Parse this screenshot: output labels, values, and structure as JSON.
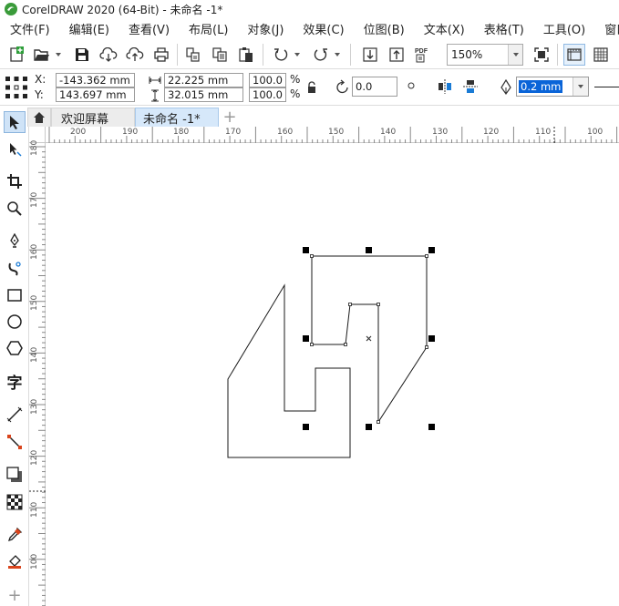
{
  "title": "CorelDRAW 2020 (64-Bit) - 未命名 -1*",
  "menu": [
    "文件(F)",
    "编辑(E)",
    "查看(V)",
    "布局(L)",
    "对象(J)",
    "效果(C)",
    "位图(B)",
    "文本(X)",
    "表格(T)",
    "工具(O)",
    "窗口"
  ],
  "toolbar": {
    "zoom_value": "150%",
    "pdf_label": "PDF"
  },
  "propbar": {
    "x_label": "X:",
    "y_label": "Y:",
    "x_value": "-143.362 mm",
    "y_value": "143.697 mm",
    "width_value": "22.225 mm",
    "height_value": "32.015 mm",
    "scale_x": "100.0",
    "scale_y": "100.0",
    "percent_x": "%",
    "percent_y": "%",
    "rotation_value": "0.0",
    "outline_width": "0.2 mm"
  },
  "tabs": {
    "welcome": "欢迎屏幕",
    "document": "未命名 -1*"
  },
  "hruler_numbers": [
    "200",
    "190",
    "180",
    "170",
    "160",
    "150",
    "140",
    "130",
    "120",
    "110",
    "100"
  ],
  "vruler_numbers": [
    "180",
    "170",
    "160",
    "150",
    "140",
    "130",
    "120",
    "110",
    "100"
  ],
  "icons": [
    "new-document-icon",
    "open-folder-icon",
    "save-icon",
    "cloud-import-icon",
    "cloud-export-icon",
    "print-icon",
    "cut-icon",
    "copy-icon",
    "paste-icon",
    "undo-icon",
    "redo-icon",
    "import-icon",
    "export-icon",
    "publish-pdf-icon",
    "full-screen-icon",
    "rulers-icon",
    "grid-icon",
    "pick-tool-icon",
    "shape-tool-icon",
    "crop-tool-icon",
    "zoom-tool-icon",
    "freehand-tool-icon",
    "artistic-media-icon",
    "rectangle-tool-icon",
    "ellipse-tool-icon",
    "polygon-tool-icon",
    "text-tool-icon",
    "parallel-dimension-icon",
    "connector-tool-icon",
    "drop-shadow-icon",
    "transparency-icon",
    "eyedropper-icon",
    "interactive-fill-icon",
    "add-tool-icon",
    "home-icon",
    "rotation-icon",
    "pen-icon"
  ]
}
